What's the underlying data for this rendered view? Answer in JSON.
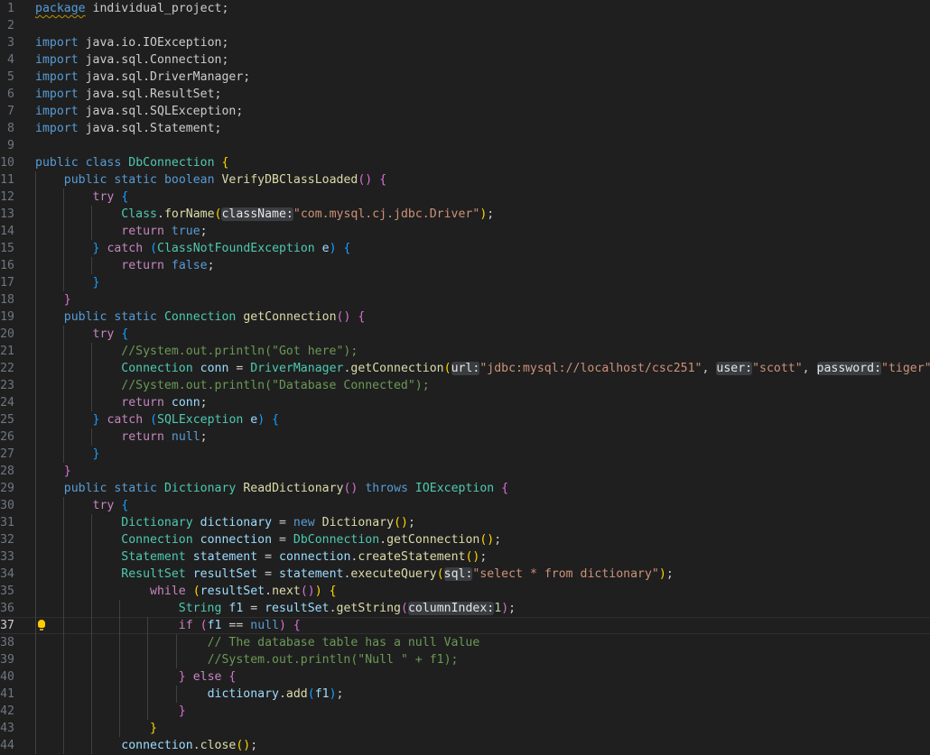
{
  "editor": {
    "current_line": 37,
    "tokens": {
      "package": "package",
      "import": "import",
      "public": "public",
      "class": "class",
      "static": "static",
      "boolean": "boolean",
      "try": "try",
      "catch": "catch",
      "return": "return",
      "true": "true",
      "false": "false",
      "null": "null",
      "new": "new",
      "throws": "throws",
      "while": "while",
      "if": "if",
      "else": "else",
      "pkg_name": "individual_project",
      "imp1": "java.io.IOException",
      "imp2": "java.sql.Connection",
      "imp3": "java.sql.DriverManager",
      "imp4": "java.sql.ResultSet",
      "imp5": "java.sql.SQLException",
      "imp6": "java.sql.Statement",
      "DbConnection": "DbConnection",
      "VerifyDBClassLoaded": "VerifyDBClassLoaded",
      "Class": "Class",
      "forName": "forName",
      "hint_className": "className:",
      "str_driver": "\"com.mysql.cj.jdbc.Driver\"",
      "ClassNotFoundException": "ClassNotFoundException",
      "e": "e",
      "Connection": "Connection",
      "getConnection": "getConnection",
      "cm_got_here": "//System.out.println(\"Got here\");",
      "conn": "conn",
      "DriverManager": "DriverManager",
      "hint_url": "url:",
      "str_url": "\"jdbc:mysql://localhost/csc251\"",
      "hint_user": "user:",
      "str_user": "\"scott\"",
      "hint_password": "password:",
      "str_password": "\"tiger\"",
      "cm_db_connected": "//System.out.println(\"Database Connected\");",
      "SQLException": "SQLException",
      "Dictionary": "Dictionary",
      "ReadDictionary": "ReadDictionary",
      "IOException": "IOException",
      "dictionary": "dictionary",
      "connection": "connection",
      "Statement": "Statement",
      "statement": "statement",
      "createStatement": "createStatement",
      "ResultSet": "ResultSet",
      "resultSet": "resultSet",
      "executeQuery": "executeQuery",
      "hint_sql": "sql:",
      "str_query": "\"select * from dictionary\"",
      "next": "next",
      "String": "String",
      "f1": "f1",
      "getString": "getString",
      "hint_columnIndex": "columnIndex:",
      "num_1": "1",
      "cm_null_value": "// The database table has a null Value",
      "cm_null_print": "//System.out.println(\"Null \" + f1);",
      "add": "add",
      "close": "close"
    }
  }
}
